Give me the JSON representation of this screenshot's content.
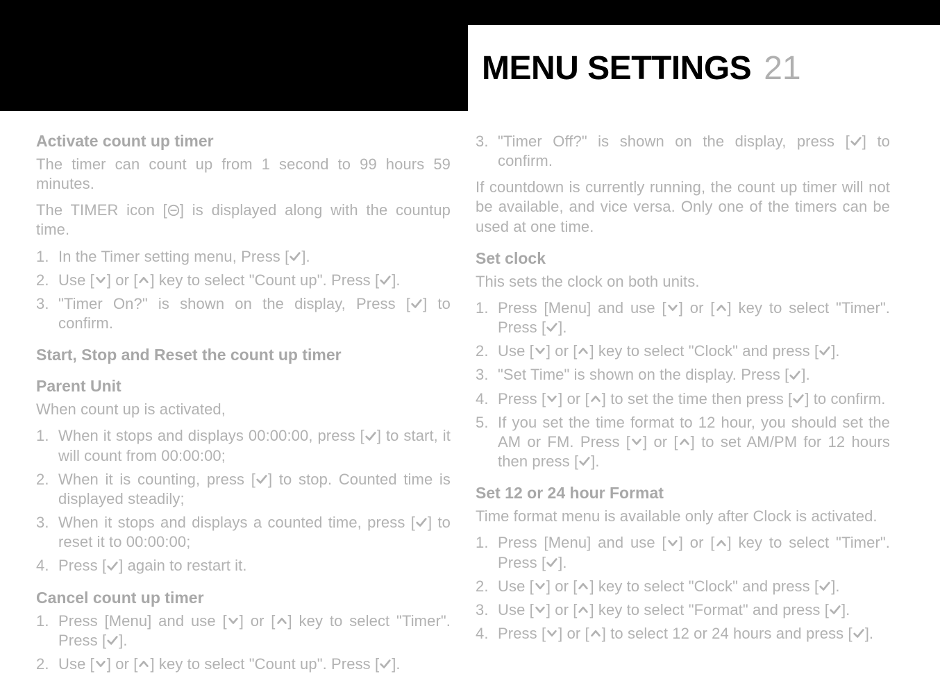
{
  "header": {
    "title": "MENU SETTINGS",
    "page_number": "21"
  },
  "left": {
    "h_activate": "Activate count up timer",
    "p_activate_intro": "The timer can count up from 1 second to 99 hours 59 minutes.",
    "p_timer_icon_pre": "The TIMER icon [",
    "p_timer_icon_post": "] is displayed along with the countup time.",
    "activate_steps": [
      {
        "pre": "In the Timer setting menu, Press [",
        "icon": "check",
        "post": "]."
      },
      {
        "pre": "Use [",
        "icon": "down",
        "mid1": "] or [",
        "icon2": "up",
        "mid2": "] key to select \"Count up\". Press [",
        "icon3": "check",
        "post": "]."
      },
      {
        "pre": "\"Timer On?\" is shown on the display, Press [",
        "icon": "check",
        "post": "] to confirm."
      }
    ],
    "h_start_stop": "Start, Stop and Reset the count up timer",
    "h_parent": "Parent Unit",
    "p_parent_intro": "When count up is activated,",
    "parent_steps": [
      {
        "pre": "When it stops and displays 00:00:00, press [",
        "icon": "check",
        "post": "] to start, it will count from 00:00:00;"
      },
      {
        "pre": "When it is counting, press [",
        "icon": "check",
        "post": "] to stop. Counted time is displayed steadily;"
      },
      {
        "pre": "When it stops and displays a counted time, press [",
        "icon": "check",
        "post": "] to reset it to 00:00:00;"
      },
      {
        "pre": "Press [",
        "icon": "check",
        "post": "] again to restart it."
      }
    ],
    "h_cancel": "Cancel count up timer",
    "cancel_steps": [
      {
        "pre": "Press [Menu] and use [",
        "icon": "down",
        "mid1": "] or [",
        "icon2": "up",
        "mid2": "] key to select \"Timer\". Press [",
        "icon3": "check",
        "post": "]."
      },
      {
        "pre": "Use [",
        "icon": "down",
        "mid1": "] or [",
        "icon2": "up",
        "mid2": "] key to select \"Count up\". Press [",
        "icon3": "check",
        "post": "]."
      }
    ]
  },
  "right": {
    "cancel_cont": [
      {
        "pre": "\"Timer Off?\" is shown on the display, press [",
        "icon": "check",
        "post": "] to confirm."
      }
    ],
    "p_note": "If countdown is currently running, the count up timer will not be available, and vice versa. Only one of the timers can be used at one time.",
    "h_setclock": "Set clock",
    "p_setclock_intro": "This sets the clock on both units.",
    "setclock_steps": [
      {
        "pre": "Press [Menu] and use [",
        "icon": "down",
        "mid1": "] or [",
        "icon2": "up",
        "mid2": "] key to select \"Timer\". Press [",
        "icon3": "check",
        "post": "]."
      },
      {
        "pre": "Use [",
        "icon": "down",
        "mid1": "] or [",
        "icon2": "up",
        "mid2": "] key to select \"Clock\" and press [",
        "icon3": "check",
        "post": "]."
      },
      {
        "pre": "\"Set Time\" is shown on the display. Press [",
        "icon": "check",
        "post": "]."
      },
      {
        "pre": "Press [",
        "icon": "down",
        "mid1": "] or [",
        "icon2": "up",
        "mid2": "] to set the time then press [",
        "icon3": "check",
        "post": "] to confirm."
      },
      {
        "pre": "If you set the time format to 12 hour, you should set the AM or FM. Press [",
        "icon": "down",
        "mid1": "] or [",
        "icon2": "up",
        "mid2": "] to set AM/PM for 12 hours then press [",
        "icon3": "check",
        "post": "]."
      }
    ],
    "h_format": "Set 12 or 24 hour Format",
    "p_format_intro": "Time format menu is available only after Clock is activated.",
    "format_steps": [
      {
        "pre": "Press [Menu] and use [",
        "icon": "down",
        "mid1": "] or [",
        "icon2": "up",
        "mid2": "] key to select \"Timer\". Press [",
        "icon3": "check",
        "post": "]."
      },
      {
        "pre": "Use [",
        "icon": "down",
        "mid1": "] or [",
        "icon2": "up",
        "mid2": "] key to select \"Clock\" and press [",
        "icon3": "check",
        "post": "]."
      },
      {
        "pre": "Use [",
        "icon": "down",
        "mid1": "] or [",
        "icon2": "up",
        "mid2": "] key to select \"Format\" and press [",
        "icon3": "check",
        "post": "]."
      },
      {
        "pre": "Press [",
        "icon": "down",
        "mid1": "] or [",
        "icon2": "up",
        "mid2": "] to select 12 or 24 hours and press [",
        "icon3": "check",
        "post": "]."
      }
    ]
  }
}
